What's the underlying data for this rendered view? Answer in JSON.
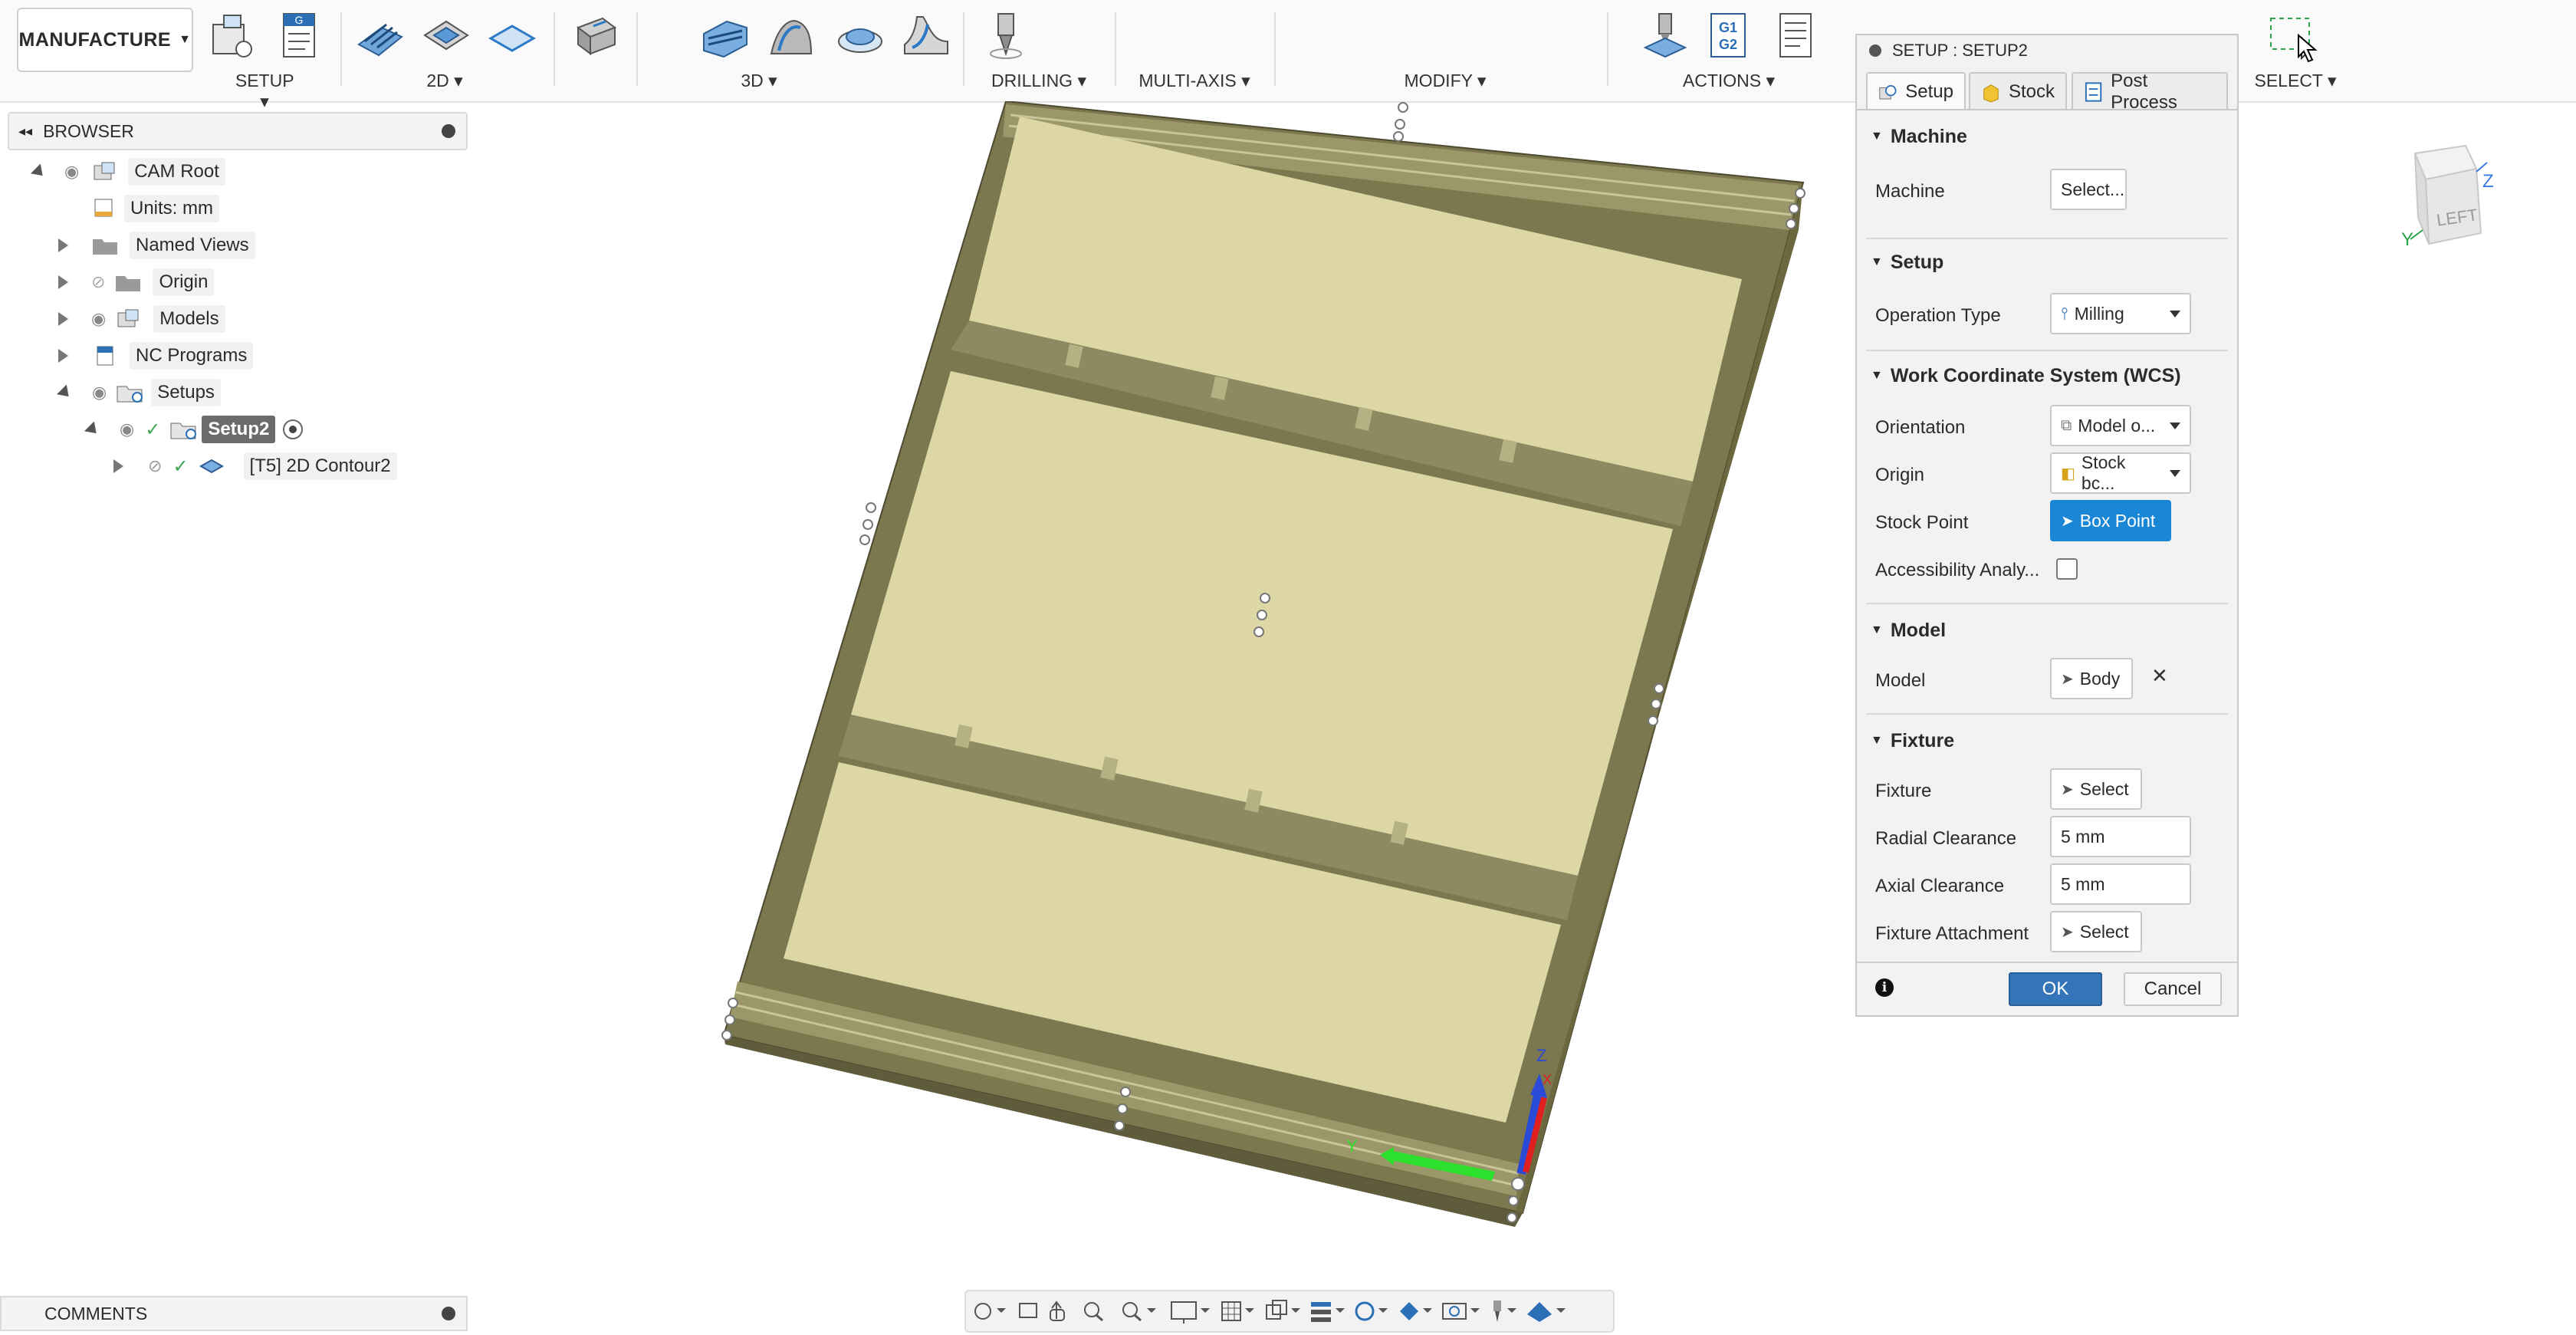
{
  "toolbar": {
    "workspace": "MANUFACTURE",
    "groups": {
      "setup": "SETUP",
      "twod": "2D",
      "threed": "3D",
      "drilling": "DRILLING",
      "multiaxis": "MULTI-AXIS",
      "modify": "MODIFY",
      "actions": "ACTIONS",
      "select": "SELECT"
    },
    "gcode_icon": "G1 G2"
  },
  "browser": {
    "title": "BROWSER",
    "items": [
      {
        "label": "CAM Root"
      },
      {
        "label": "Units: mm"
      },
      {
        "label": "Named Views"
      },
      {
        "label": "Origin"
      },
      {
        "label": "Models"
      },
      {
        "label": "NC Programs"
      },
      {
        "label": "Setups"
      },
      {
        "label": "Setup2"
      },
      {
        "label": "[T5] 2D Contour2"
      }
    ]
  },
  "comments": {
    "title": "COMMENTS"
  },
  "viewcube": {
    "face": "LEFT",
    "axis_z": "Z",
    "axis_y": "Y"
  },
  "triad": {
    "z": "Z",
    "y": "Y",
    "x": "X"
  },
  "dialog": {
    "title": "SETUP : SETUP2",
    "tabs": [
      "Setup",
      "Stock",
      "Post Process"
    ],
    "sections": {
      "machine": "Machine",
      "setup": "Setup",
      "wcs": "Work Coordinate System (WCS)",
      "model": "Model",
      "fixture": "Fixture"
    },
    "fields": {
      "machine_label": "Machine",
      "machine_value": "Select...",
      "operation_type_label": "Operation Type",
      "operation_type_value": "Milling",
      "orientation_label": "Orientation",
      "orientation_value": "Model o...",
      "origin_label": "Origin",
      "origin_value": "Stock bc...",
      "stock_point_label": "Stock Point",
      "stock_point_value": "Box Point",
      "accessibility_label": "Accessibility Analy...",
      "accessibility_checked": false,
      "model_label": "Model",
      "model_value": "Body",
      "fixture_label": "Fixture",
      "fixture_value": "Select",
      "radial_label": "Radial Clearance",
      "radial_value": "5 mm",
      "axial_label": "Axial Clearance",
      "axial_value": "5 mm",
      "attachment_label": "Fixture Attachment",
      "attachment_value": "Select"
    },
    "ok": "OK",
    "cancel": "Cancel"
  },
  "colors": {
    "accent": "#1a86d6",
    "ok_button": "#3474b8",
    "part_face": "#dcd7a4",
    "part_wall": "#7b774f",
    "part_wall_dark": "#5f5c3b"
  }
}
